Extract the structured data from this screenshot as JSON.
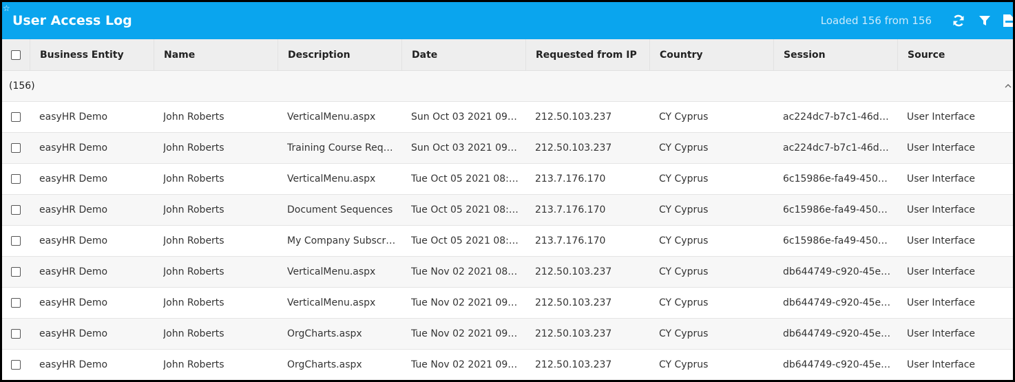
{
  "header": {
    "title": "User Access Log",
    "loaded_text": "Loaded 156 from 156"
  },
  "colors": {
    "titlebar": "#0aa5ee",
    "header_bg": "#eeeeee"
  },
  "icons": [
    "star-icon",
    "refresh-icon",
    "filter-icon",
    "export-icon",
    "chevron-up-icon"
  ],
  "columns": [
    "Business Entity",
    "Name",
    "Description",
    "Date",
    "Requested from IP",
    "Country",
    "Session",
    "Source"
  ],
  "group": {
    "label": "(156)"
  },
  "rows": [
    [
      "easyHR Demo",
      "John Roberts",
      "VerticalMenu.aspx",
      "Sun Oct 03 2021 09:01...",
      "212.50.103.237",
      "CY Cyprus",
      "ac224dc7-b7c1-46d7-...",
      "User Interface"
    ],
    [
      "easyHR Demo",
      "John Roberts",
      "Training Course Reque...",
      "Sun Oct 03 2021 09:01...",
      "212.50.103.237",
      "CY Cyprus",
      "ac224dc7-b7c1-46d7-...",
      "User Interface"
    ],
    [
      "easyHR Demo",
      "John Roberts",
      "VerticalMenu.aspx",
      "Tue Oct 05 2021 08:08...",
      "213.7.176.170",
      "CY Cyprus",
      "6c15986e-fa49-450e-a...",
      "User Interface"
    ],
    [
      "easyHR Demo",
      "John Roberts",
      "Document Sequences",
      "Tue Oct 05 2021 08:10...",
      "213.7.176.170",
      "CY Cyprus",
      "6c15986e-fa49-450e-a...",
      "User Interface"
    ],
    [
      "easyHR Demo",
      "John Roberts",
      "My Company Subscrip...",
      "Tue Oct 05 2021 08:11...",
      "213.7.176.170",
      "CY Cyprus",
      "6c15986e-fa49-450e-a...",
      "User Interface"
    ],
    [
      "easyHR Demo",
      "John Roberts",
      "VerticalMenu.aspx",
      "Tue Nov 02 2021 08:5...",
      "212.50.103.237",
      "CY Cyprus",
      "db644749-c920-45ec-...",
      "User Interface"
    ],
    [
      "easyHR Demo",
      "John Roberts",
      "VerticalMenu.aspx",
      "Tue Nov 02 2021 09:0...",
      "212.50.103.237",
      "CY Cyprus",
      "db644749-c920-45ec-...",
      "User Interface"
    ],
    [
      "easyHR Demo",
      "John Roberts",
      "OrgCharts.aspx",
      "Tue Nov 02 2021 09:1...",
      "212.50.103.237",
      "CY Cyprus",
      "db644749-c920-45ec-...",
      "User Interface"
    ],
    [
      "easyHR Demo",
      "John Roberts",
      "OrgCharts.aspx",
      "Tue Nov 02 2021 09:1...",
      "212.50.103.237",
      "CY Cyprus",
      "db644749-c920-45ec-...",
      "User Interface"
    ]
  ]
}
